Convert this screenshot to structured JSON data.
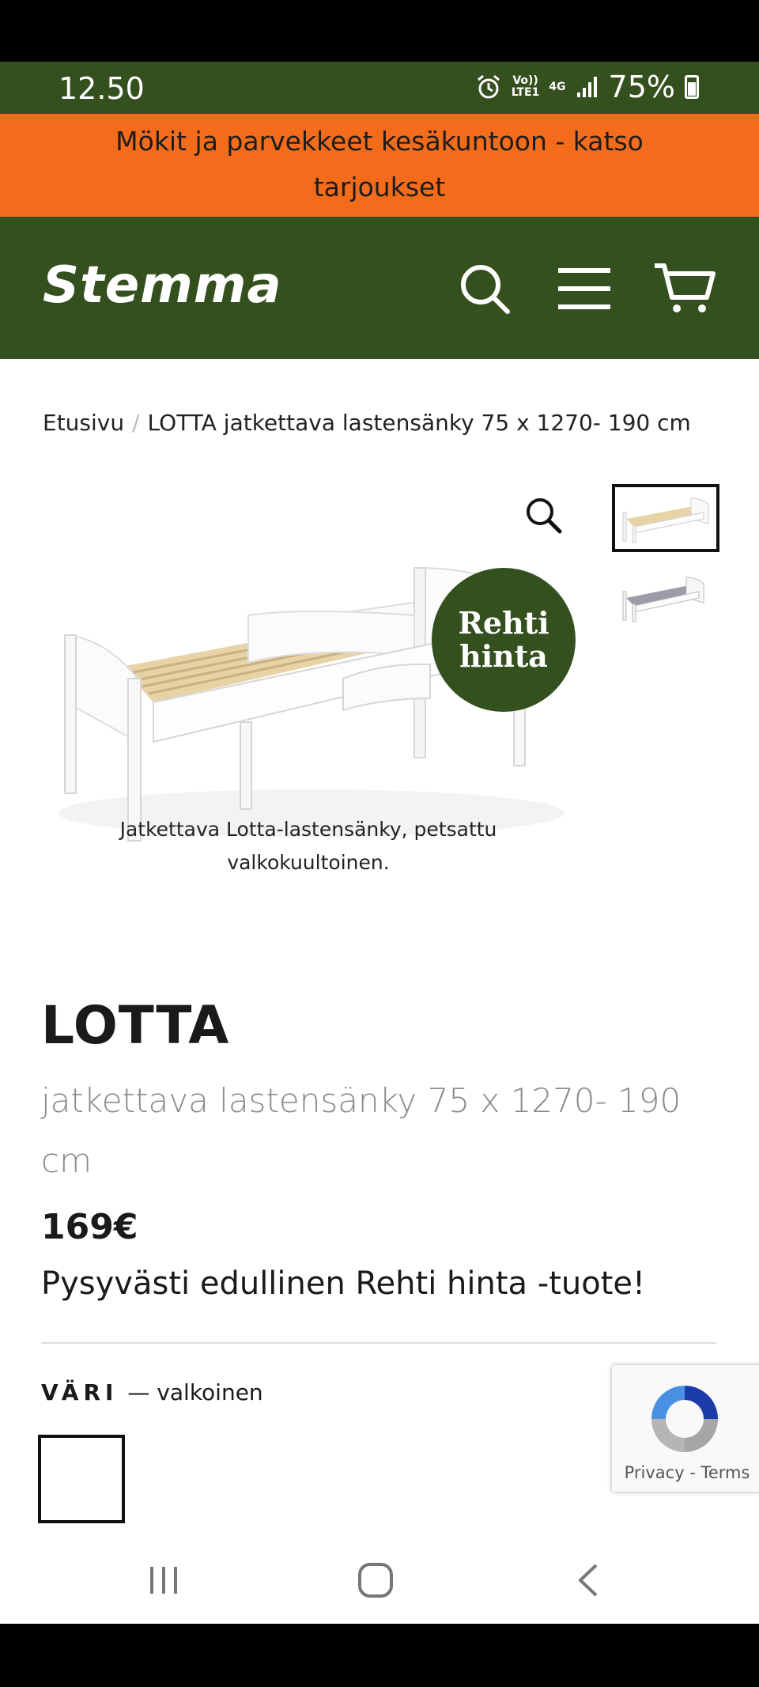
{
  "status_bar": {
    "time": "12.50",
    "network_top": "Vo))",
    "network_bottom": "LTE1",
    "signal_type": "4G",
    "battery": "75%"
  },
  "promo_banner": {
    "text": "Mökit ja parvekkeet kesäkuntoon - katso tarjoukset"
  },
  "header": {
    "logo": "Stemma",
    "icons": [
      "search-icon",
      "menu-icon",
      "cart-icon"
    ]
  },
  "breadcrumb": {
    "home": "Etusivu",
    "separator": "/",
    "current": "LOTTA jatkettava lastensänky 75 x 1270- 190 cm"
  },
  "gallery": {
    "badge_line1": "Rehti",
    "badge_line2": "hinta",
    "caption": "Jatkettava Lotta-lastensänky, petsattu valkokuultoinen."
  },
  "product": {
    "title": "LOTTA",
    "subtitle": "jatkettava lastensänky 75 x 1270- 190 cm",
    "price": "169€",
    "tagline": "Pysyvästi edullinen Rehti hinta -tuote!",
    "variant_key": "VÄRI",
    "variant_value": "— valkoinen"
  },
  "recaptcha": {
    "text": "Privacy - Terms"
  },
  "colors": {
    "brand_green": "#35501f",
    "promo_orange": "#f36c1b"
  }
}
